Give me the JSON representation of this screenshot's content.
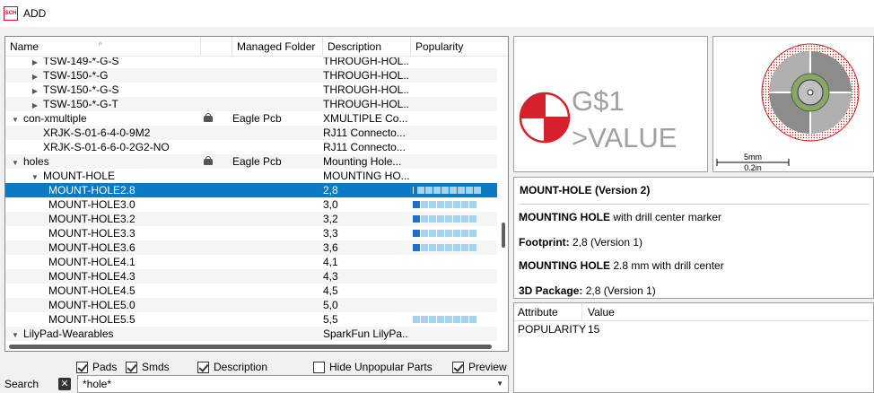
{
  "window": {
    "title": "ADD",
    "icon": "sch-app-icon"
  },
  "tree": {
    "columns": [
      "Name",
      "Managed Folder",
      "Description",
      "Popularity"
    ],
    "rows": [
      {
        "name": "TSW-149-*-G-S",
        "level": 1,
        "expander": "collapsed",
        "folder": "",
        "locked": false,
        "description": "THROUGH-HOL...",
        "popularity": null
      },
      {
        "name": "TSW-150-*-G",
        "level": 1,
        "expander": "collapsed",
        "folder": "",
        "locked": false,
        "description": "THROUGH-HOL...",
        "popularity": null
      },
      {
        "name": "TSW-150-*-G-S",
        "level": 1,
        "expander": "collapsed",
        "folder": "",
        "locked": false,
        "description": "THROUGH-HOL...",
        "popularity": null
      },
      {
        "name": "TSW-150-*-G-T",
        "level": 1,
        "expander": "collapsed",
        "folder": "",
        "locked": false,
        "description": "THROUGH-HOL...",
        "popularity": null
      },
      {
        "name": "con-xmultiple",
        "level": 0,
        "expander": "expanded",
        "folder": "Eagle Pcb",
        "locked": true,
        "description": "XMULTIPLE Co...",
        "popularity": null
      },
      {
        "name": "XRJK-S-01-6-4-0-9M2",
        "level": 1,
        "expander": "none",
        "folder": "",
        "locked": false,
        "description": "RJ11 Connecto...",
        "popularity": null
      },
      {
        "name": "XRJK-S-01-6-6-0-2G2-NO",
        "level": 1,
        "expander": "none",
        "folder": "",
        "locked": false,
        "description": "RJ11 Connecto...",
        "popularity": null
      },
      {
        "name": "holes",
        "level": 0,
        "expander": "expanded",
        "folder": "Eagle Pcb",
        "locked": true,
        "description": "Mounting Hole...",
        "popularity": null
      },
      {
        "name": "MOUNT-HOLE",
        "level": 1,
        "expander": "expanded",
        "folder": "",
        "locked": false,
        "description": "MOUNTING HO...",
        "popularity": null
      },
      {
        "name": "MOUNT-HOLE2.8",
        "level": 2,
        "expander": "none",
        "folder": "",
        "locked": false,
        "description": "2,8",
        "popularity": 1,
        "selected": true
      },
      {
        "name": "MOUNT-HOLE3.0",
        "level": 2,
        "expander": "none",
        "folder": "",
        "locked": false,
        "description": "3,0",
        "popularity": 1
      },
      {
        "name": "MOUNT-HOLE3.2",
        "level": 2,
        "expander": "none",
        "folder": "",
        "locked": false,
        "description": "3,2",
        "popularity": 1
      },
      {
        "name": "MOUNT-HOLE3.3",
        "level": 2,
        "expander": "none",
        "folder": "",
        "locked": false,
        "description": "3,3",
        "popularity": 1
      },
      {
        "name": "MOUNT-HOLE3.6",
        "level": 2,
        "expander": "none",
        "folder": "",
        "locked": false,
        "description": "3,6",
        "popularity": 1
      },
      {
        "name": "MOUNT-HOLE4.1",
        "level": 2,
        "expander": "none",
        "folder": "",
        "locked": false,
        "description": "4,1",
        "popularity": null
      },
      {
        "name": "MOUNT-HOLE4.3",
        "level": 2,
        "expander": "none",
        "folder": "",
        "locked": false,
        "description": "4,3",
        "popularity": null
      },
      {
        "name": "MOUNT-HOLE4.5",
        "level": 2,
        "expander": "none",
        "folder": "",
        "locked": false,
        "description": "4,5",
        "popularity": null
      },
      {
        "name": "MOUNT-HOLE5.0",
        "level": 2,
        "expander": "none",
        "folder": "",
        "locked": false,
        "description": "5,0",
        "popularity": null
      },
      {
        "name": "MOUNT-HOLE5.5",
        "level": 2,
        "expander": "none",
        "folder": "",
        "locked": false,
        "description": "5,5",
        "popularity": 0
      },
      {
        "name": "LilyPad-Wearables",
        "level": 0,
        "expander": "expanded",
        "folder": "",
        "locked": false,
        "description": "SparkFun LilyPa...",
        "popularity": null
      }
    ]
  },
  "options": {
    "pads": {
      "label": "Pads",
      "checked": true
    },
    "smds": {
      "label": "Smds",
      "checked": true
    },
    "description": {
      "label": "Description",
      "checked": true
    },
    "hide_unpopular": {
      "label": "Hide Unpopular Parts",
      "checked": false
    },
    "preview": {
      "label": "Preview",
      "checked": true
    }
  },
  "search": {
    "label": "Search",
    "value": "*hole*"
  },
  "symbol_preview": {
    "name_text": "G$1",
    "value_text": ">VALUE"
  },
  "package_preview": {
    "scale_top": "5mm",
    "scale_bottom": "0.2in"
  },
  "description": {
    "title": "MOUNT-HOLE (Version 2)",
    "l1_bold": "MOUNTING HOLE",
    "l1_rest": " with drill center marker",
    "l2_bold": "Footprint:",
    "l2_rest": " 2,8 (Version 1)",
    "l3_bold": "MOUNTING HOLE",
    "l3_rest": " 2.8 mm with drill center",
    "l4_bold": "3D Package:",
    "l4_rest": " 2,8 (Version 1)"
  },
  "attributes": {
    "headers": [
      "Attribute",
      "Value"
    ],
    "rows": [
      {
        "attribute": "POPULARITY",
        "value": "15"
      }
    ]
  },
  "colors": {
    "selection": "#0a7ac2",
    "symbol_red": "#d6222d",
    "symbol_text": "#a0a0a0",
    "pop_on": "#1a73c9",
    "pop_off": "#a6d3ee"
  }
}
